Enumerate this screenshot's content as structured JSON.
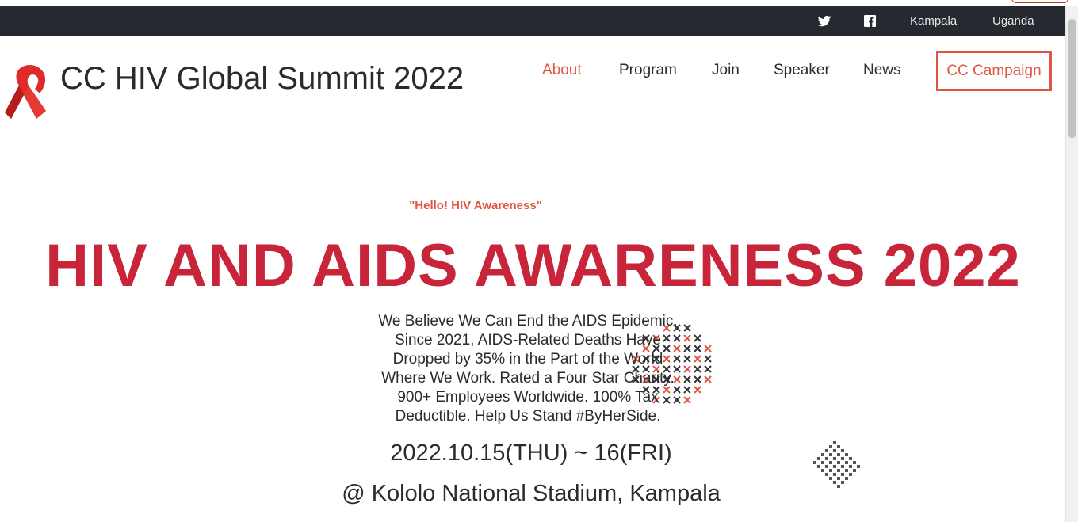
{
  "topbar": {
    "twitter_icon": "twitter-icon",
    "facebook_icon": "facebook-icon",
    "links": [
      "Kampala",
      "Uganda"
    ]
  },
  "header": {
    "logo_icon": "red-ribbon-icon",
    "site_title": "CC HIV Global Summit 2022",
    "nav": {
      "about": "About",
      "program": "Program",
      "join": "Join",
      "speaker": "Speaker",
      "news": "News",
      "campaign": "CC Campaign"
    }
  },
  "hero": {
    "tagline": "\"Hello! HIV Awareness\"",
    "headline": "HIV AND AIDS AWARENESS 2022",
    "description": "We Believe We Can End the AIDS Epidemic. Since 2021, AIDS-Related Deaths Have Dropped by 35% in the Part of the World Where We Work. Rated a Four Star Charity. 900+ Employees Worldwide. 100% Tax Deductible. Help Us Stand #ByHerSide.",
    "dates": "2022.10.15(THU) ~ 16(FRI)",
    "venue": "@ Kololo National Stadium, Kampala"
  },
  "colors": {
    "accent": "#e05640",
    "headline": "#c8243a",
    "topbar_bg": "#262a30"
  }
}
